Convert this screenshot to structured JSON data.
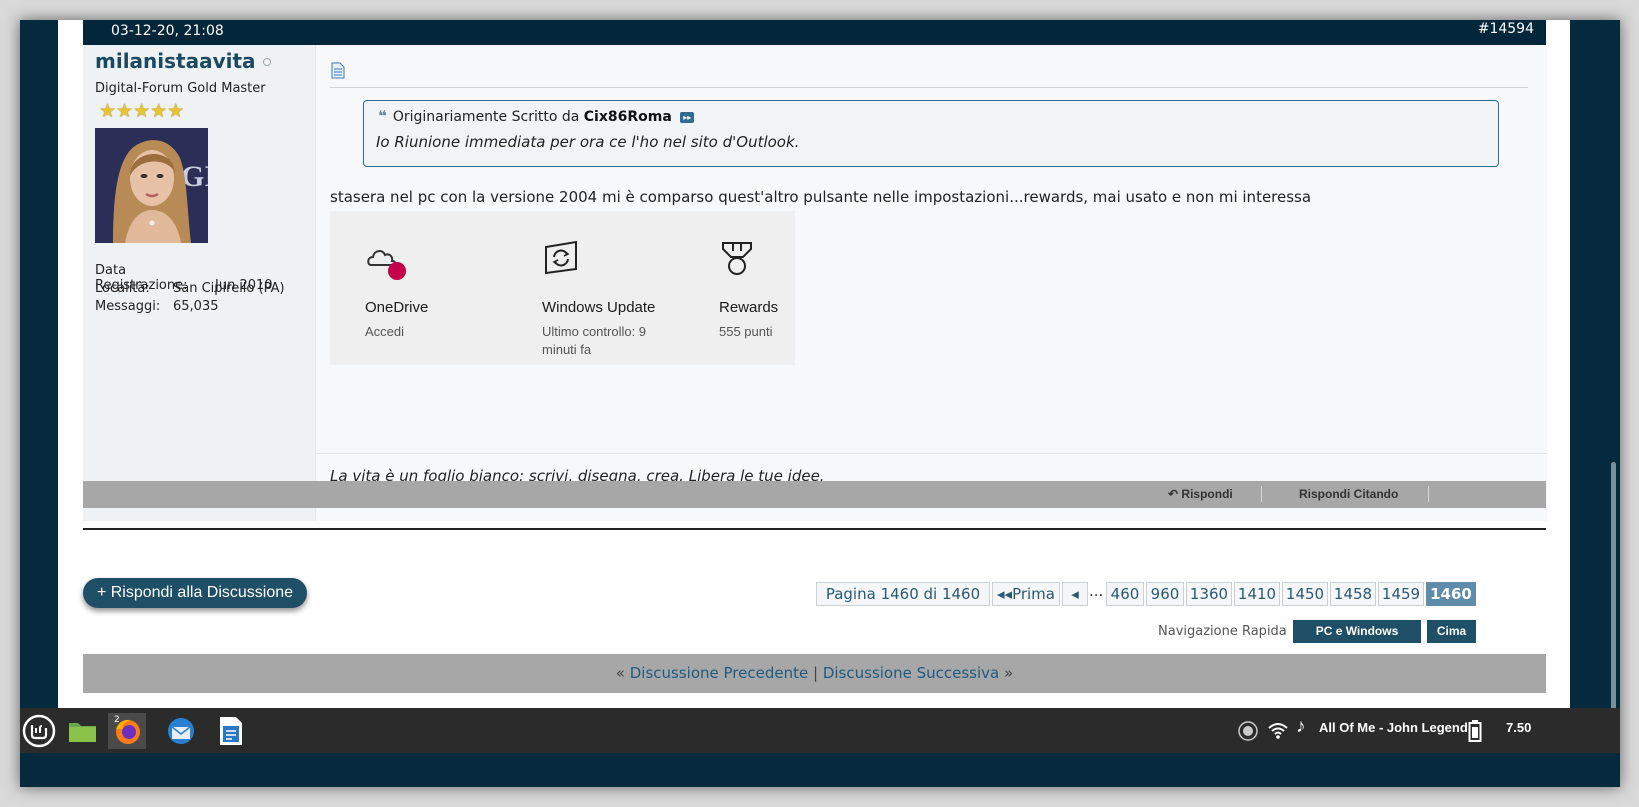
{
  "post": {
    "date": "03-12-20, 21:08",
    "number": "#14594",
    "username": "milanistaavita",
    "user_title": "Digital-Forum Gold Master",
    "stars": "★★★★★",
    "info": [
      {
        "label": "Data Registrazione:",
        "value": "Jun 2010"
      },
      {
        "label": "Località:",
        "value": "San Cipirello (PA)"
      },
      {
        "label": "Messaggi:",
        "value": "65,035"
      }
    ],
    "quote_prefix": "Originariamente Scritto da",
    "quote_author": "Cix86Roma",
    "quote_text": "Io Riunione immediata per ora ce l'ho nel sito d'Outlook.",
    "message": "stasera nel pc con la versione 2004 mi è comparso quest'altro pulsante nelle impostazioni...rewards, mai usato e non mi interessa",
    "signature": "La vita è un foglio bianco: scrivi, disegna, crea. Libera le tue idee.",
    "tiles": [
      {
        "name": "OneDrive",
        "sub": "Accedi",
        "icon": "cloud-icon"
      },
      {
        "name": "Windows Update",
        "sub": "Ultimo controllo: 9 minuti fa",
        "icon": "sync-icon"
      },
      {
        "name": "Rewards",
        "sub": "555 punti",
        "icon": "medal-icon"
      }
    ],
    "actions": {
      "reply": "Rispondi",
      "reply_quote": "Rispondi Citando"
    }
  },
  "reply_thread": "+ Rispondi alla Discussione",
  "pager": {
    "label": "Pagina 1460 di 1460",
    "first": "Prima",
    "prev": "◂",
    "dots": "...",
    "pages": [
      "460",
      "960",
      "1360",
      "1410",
      "1450",
      "1458",
      "1459",
      "1460"
    ],
    "current": "1460"
  },
  "quicknav": {
    "label": "Navigazione Rapida",
    "forum": "PC e Windows",
    "top": "Cima"
  },
  "threadnav": {
    "prev": "Discussione Precedente",
    "next": "Discussione Successiva",
    "lq": "«",
    "rq": "»",
    "sep": "|"
  },
  "taskbar": {
    "firefox_badge": "2",
    "now_playing": "All Of Me - John Legend",
    "clock": "7.50",
    "apps": [
      "mint-menu-icon",
      "files-icon",
      "firefox-icon",
      "thunderbird-icon",
      "writer-icon"
    ]
  },
  "colors": {
    "dark": "#05293d",
    "accent": "#1f4f66",
    "link": "#1f5a80"
  }
}
